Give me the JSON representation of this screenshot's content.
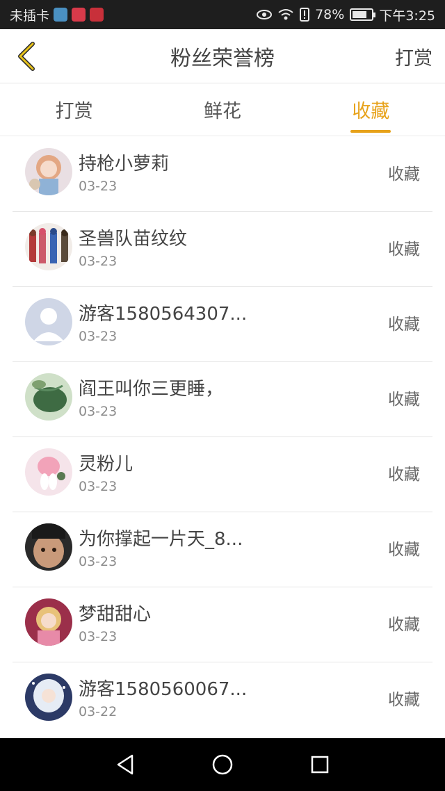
{
  "status_bar": {
    "carrier": "未插卡",
    "battery_text": "78%",
    "battery_level": 0.78,
    "time": "下午3:25"
  },
  "header": {
    "title": "粉丝荣誉榜",
    "right_action": "打赏",
    "accent_color": "#e7a21a"
  },
  "tabs": [
    {
      "label": "打赏",
      "active": false
    },
    {
      "label": "鲜花",
      "active": false
    },
    {
      "label": "收藏",
      "active": true
    }
  ],
  "fans": [
    {
      "name": "持枪小萝莉",
      "date": "03-23",
      "action": "收藏",
      "avatar": "anime-girl-avatar"
    },
    {
      "name": "圣兽队苗纹纹",
      "date": "03-23",
      "action": "收藏",
      "avatar": "group-figures-avatar"
    },
    {
      "name": "游客1580564307...",
      "date": "03-23",
      "action": "收藏",
      "avatar": "default-user-avatar"
    },
    {
      "name": "阎王叫你三更睡，",
      "date": "03-23",
      "action": "收藏",
      "avatar": "leaf-avatar"
    },
    {
      "name": "灵粉儿",
      "date": "03-23",
      "action": "收藏",
      "avatar": "bunny-girl-avatar"
    },
    {
      "name": "为你撑起一片天_8...",
      "date": "03-23",
      "action": "收藏",
      "avatar": "child-photo-avatar"
    },
    {
      "name": "梦甜甜心",
      "date": "03-23",
      "action": "收藏",
      "avatar": "pink-anime-avatar"
    },
    {
      "name": "游客1580560067...",
      "date": "03-22",
      "action": "收藏",
      "avatar": "white-hair-anime-avatar"
    }
  ]
}
